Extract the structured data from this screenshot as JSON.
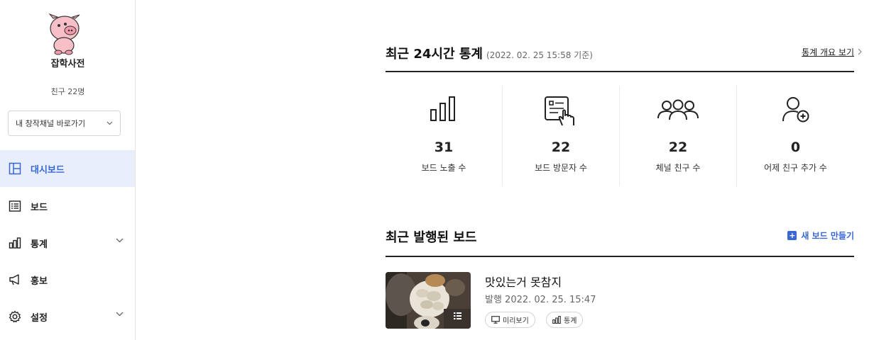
{
  "sidebar": {
    "channel_name": "잡학사전",
    "friends": "친구 22명",
    "channel_select": "내 창작채널 바로가기",
    "items": [
      {
        "label": "대시보드",
        "icon": "dashboard-icon",
        "active": true
      },
      {
        "label": "보드",
        "icon": "list-icon"
      },
      {
        "label": "통계",
        "icon": "chart-icon"
      },
      {
        "label": "홍보",
        "icon": "megaphone-icon"
      },
      {
        "label": "설정",
        "icon": "gear-icon"
      }
    ]
  },
  "stats_section": {
    "title": "최근 24시간 통계",
    "subtitle": "(2022. 02. 25 15:58 기준)",
    "overview_link": "통계 개요 보기",
    "stats": [
      {
        "value": "31",
        "label": "보드 노출 수",
        "icon": "bar-chart-icon"
      },
      {
        "value": "22",
        "label": "보드 방문자 수",
        "icon": "click-board-icon"
      },
      {
        "value": "22",
        "label": "체널 친구 수",
        "icon": "group-icon"
      },
      {
        "value": "0",
        "label": "어제 친구 추가 수",
        "icon": "add-user-icon"
      }
    ]
  },
  "boards_section": {
    "title": "최근 발행된 보드",
    "new_board": "새 보드 만들기",
    "board": {
      "title": "맛있는거 못참지",
      "date": "발행 2022. 02. 25. 15:47",
      "preview": "미리보기",
      "stats": "통계"
    }
  },
  "colors": {
    "accent": "#3866d3",
    "active_bg": "#e8effb"
  }
}
